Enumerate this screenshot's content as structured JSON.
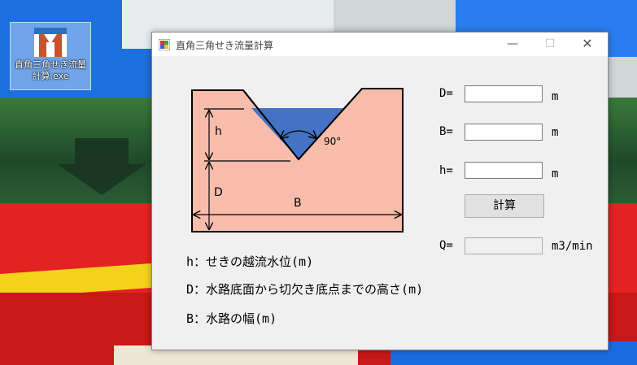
{
  "desktop": {
    "icon_label_line1": "直角三角せき流量",
    "icon_label_line2": "計算.exe"
  },
  "window": {
    "title": "直角三角せき流量計算",
    "controls": {
      "minimize": "—",
      "maximize": "☐",
      "close": "✕"
    }
  },
  "diagram": {
    "label_h": "h",
    "label_d": "D",
    "label_b": "B",
    "angle_label": "90°",
    "colors": {
      "body": "#f8bcaa",
      "water": "#4472c4",
      "outline": "#000000"
    }
  },
  "inputs": {
    "d": {
      "label": "D=",
      "value": "",
      "unit": "m"
    },
    "b": {
      "label": "B=",
      "value": "",
      "unit": "m"
    },
    "h": {
      "label": "h=",
      "value": "",
      "unit": "m"
    }
  },
  "calc_button_label": "計算",
  "result": {
    "label": "Q=",
    "value": "",
    "unit": "m3/min"
  },
  "legend": {
    "h": "h：せきの越流水位(m)",
    "d": "D：水路底面から切欠き底点までの高さ(m)",
    "b": "B：水路の幅(m)"
  }
}
